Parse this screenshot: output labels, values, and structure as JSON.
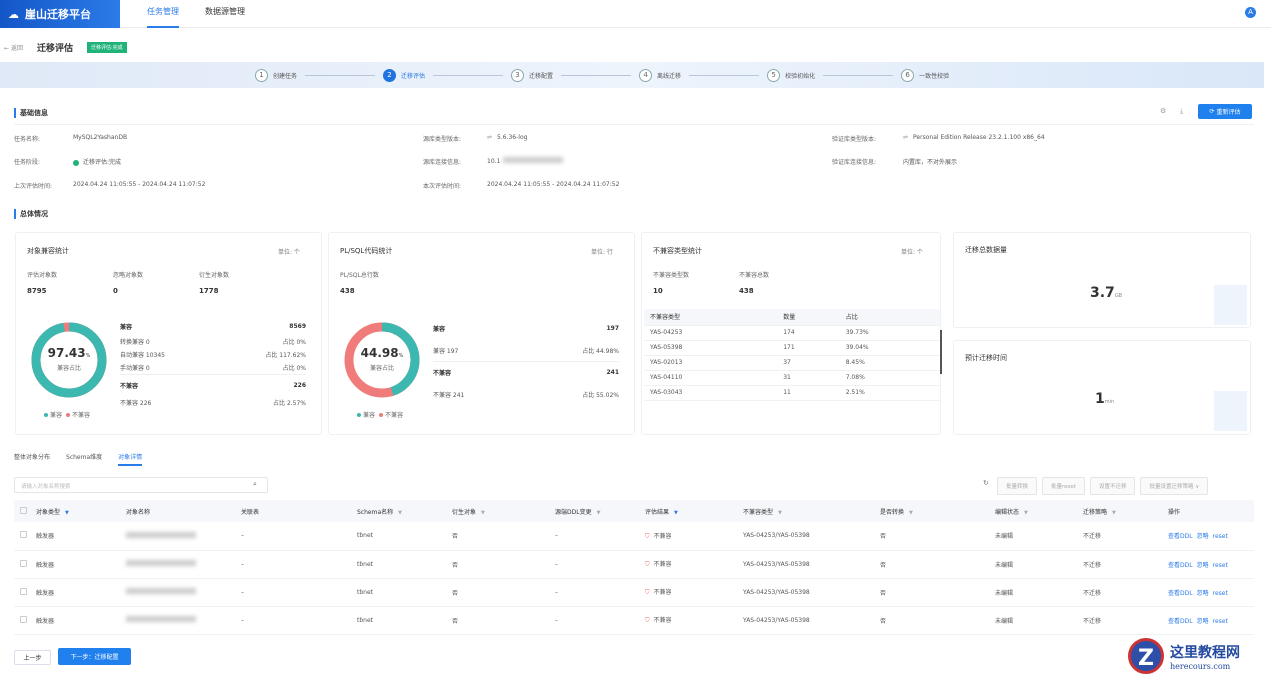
{
  "app": {
    "title": "崖山迁移平台",
    "nav": [
      "任务管理",
      "数据源管理"
    ],
    "avatar": "A"
  },
  "header": {
    "back": "返回",
    "title": "迁移评估",
    "badge": "迁移评估:完成"
  },
  "steps": [
    {
      "n": "1",
      "label": "创建任务"
    },
    {
      "n": "2",
      "label": "迁移评估"
    },
    {
      "n": "3",
      "label": "迁移配置"
    },
    {
      "n": "4",
      "label": "离线迁移"
    },
    {
      "n": "5",
      "label": "校验初始化"
    },
    {
      "n": "6",
      "label": "一致性校验"
    }
  ],
  "basic": {
    "title": "基础信息",
    "refresh": "重新评估",
    "fields": [
      {
        "label": "任务名称:",
        "value": "MySQL2YashanDB"
      },
      {
        "label": "任务阶段:",
        "value": "迁移评估:完成"
      },
      {
        "label": "上次评估时间:",
        "value": "2024.04.24 11:05:55 - 2024.04.24 11:07:52"
      },
      {
        "label": "源库类型版本:",
        "value": "5.6.36-log"
      },
      {
        "label": "源库连接信息:",
        "value": "10.1"
      },
      {
        "label": "本次评估时间:",
        "value": "2024.04.24 11:05:55 - 2024.04.24 11:07:52"
      },
      {
        "label": "验证库类型版本:",
        "value": "Personal Edition Release 23.2.1.100 x86_64"
      },
      {
        "label": "验证库连接信息:",
        "value": "内置库，不对外展示"
      }
    ]
  },
  "overview": {
    "title": "总体情况",
    "obj": {
      "title": "对象兼容统计",
      "unit": "单位: 个",
      "stats": [
        {
          "label": "评估对象数",
          "value": "8795"
        },
        {
          "label": "忽略对象数",
          "value": "0"
        },
        {
          "label": "衍生对象数",
          "value": "1778"
        }
      ],
      "percent": "97.43",
      "pct_sign": "%",
      "center_label": "兼容占比",
      "compatible": 97.43,
      "rows": [
        {
          "a": "兼容",
          "b": "8569",
          "bold": true
        },
        {
          "a": "转换兼容 0",
          "b": "占比 0%"
        },
        {
          "a": "自动兼容 10345",
          "b": "占比 117.62%"
        },
        {
          "a": "手动兼容 0",
          "b": "占比 0%"
        },
        {
          "a": "不兼容",
          "b": "226",
          "bold": true
        },
        {
          "a": "不兼容 226",
          "b": "占比 2.57%"
        }
      ],
      "legend": [
        "兼容",
        "不兼容"
      ]
    },
    "plsql": {
      "title": "PL/SQL代码统计",
      "unit": "单位: 行",
      "stats": [
        {
          "label": "PL/SQL总行数",
          "value": "438"
        }
      ],
      "percent": "44.98",
      "pct_sign": "%",
      "center_label": "兼容占比",
      "compatible": 44.98,
      "rows": [
        {
          "a": "兼容",
          "b": "197",
          "bold": true
        },
        {
          "a": "兼容 197",
          "b": "占比 44.98%"
        },
        {
          "a": "不兼容",
          "b": "241",
          "bold": true
        },
        {
          "a": "不兼容 241",
          "b": "占比 55.02%"
        }
      ],
      "legend": [
        "兼容",
        "不兼容"
      ]
    },
    "incompat": {
      "title": "不兼容类型统计",
      "unit": "单位: 个",
      "stats": [
        {
          "label": "不兼容类型数",
          "value": "10"
        },
        {
          "label": "不兼容总数",
          "value": "438"
        }
      ],
      "headers": [
        "不兼容类型",
        "数量",
        "占比"
      ],
      "rows": [
        [
          "YAS-04253",
          "174",
          "39.73%"
        ],
        [
          "YAS-05398",
          "171",
          "39.04%"
        ],
        [
          "YAS-02013",
          "37",
          "8.45%"
        ],
        [
          "YAS-04110",
          "31",
          "7.08%"
        ],
        [
          "YAS-03043",
          "11",
          "2.51%"
        ]
      ]
    },
    "volume": {
      "title": "迁移总数据量",
      "value": "3.7",
      "unit": "GB"
    },
    "time": {
      "title": "预计迁移时间",
      "value": "1",
      "unit": "min"
    }
  },
  "detail": {
    "tabs": [
      "整体对象分布",
      "Schema维度",
      "对象详情"
    ],
    "search_placeholder": "请输入对象名称搜索",
    "toolbar": [
      "批量转换",
      "批量reset",
      "设置不迁移",
      "批量设置迁移策略 ∨"
    ],
    "columns": [
      "对象类型",
      "对象名称",
      "关联表",
      "Schema名称",
      "衍生对象",
      "源端DDL变更",
      "评估结果",
      "不兼容类型",
      "是否转换",
      "编辑状态",
      "迁移策略",
      "操作"
    ],
    "rows": [
      {
        "type": "触发器",
        "rel": "–",
        "schema": "tbnet",
        "derived": "否",
        "ddl": "–",
        "result": "不兼容",
        "itype": "YAS-04253/YAS-05398",
        "conv": "否",
        "edit": "未编辑",
        "strategy": "不迁移",
        "ops": [
          "查看DDL",
          "忽略",
          "reset"
        ]
      },
      {
        "type": "触发器",
        "rel": "–",
        "schema": "tbnet",
        "derived": "否",
        "ddl": "–",
        "result": "不兼容",
        "itype": "YAS-04253/YAS-05398",
        "conv": "否",
        "edit": "未编辑",
        "strategy": "不迁移",
        "ops": [
          "查看DDL",
          "忽略",
          "reset"
        ]
      },
      {
        "type": "触发器",
        "rel": "–",
        "schema": "tbnet",
        "derived": "否",
        "ddl": "–",
        "result": "不兼容",
        "itype": "YAS-04253/YAS-05398",
        "conv": "否",
        "edit": "未编辑",
        "strategy": "不迁移",
        "ops": [
          "查看DDL",
          "忽略",
          "reset"
        ]
      },
      {
        "type": "触发器",
        "rel": "–",
        "schema": "tbnet",
        "derived": "否",
        "ddl": "–",
        "result": "不兼容",
        "itype": "YAS-04253/YAS-05398",
        "conv": "否",
        "edit": "未编辑",
        "strategy": "不迁移",
        "ops": [
          "查看DDL",
          "忽略",
          "reset"
        ]
      }
    ]
  },
  "footer": {
    "prev": "上一步",
    "next": "下一步：迁移配置"
  },
  "watermark": {
    "title": "这里教程网",
    "url": "herecours.com"
  },
  "colors": {
    "primary": "#2b7be8",
    "compatible": "#3cb8b0",
    "incompatible": "#ef7b7b"
  }
}
